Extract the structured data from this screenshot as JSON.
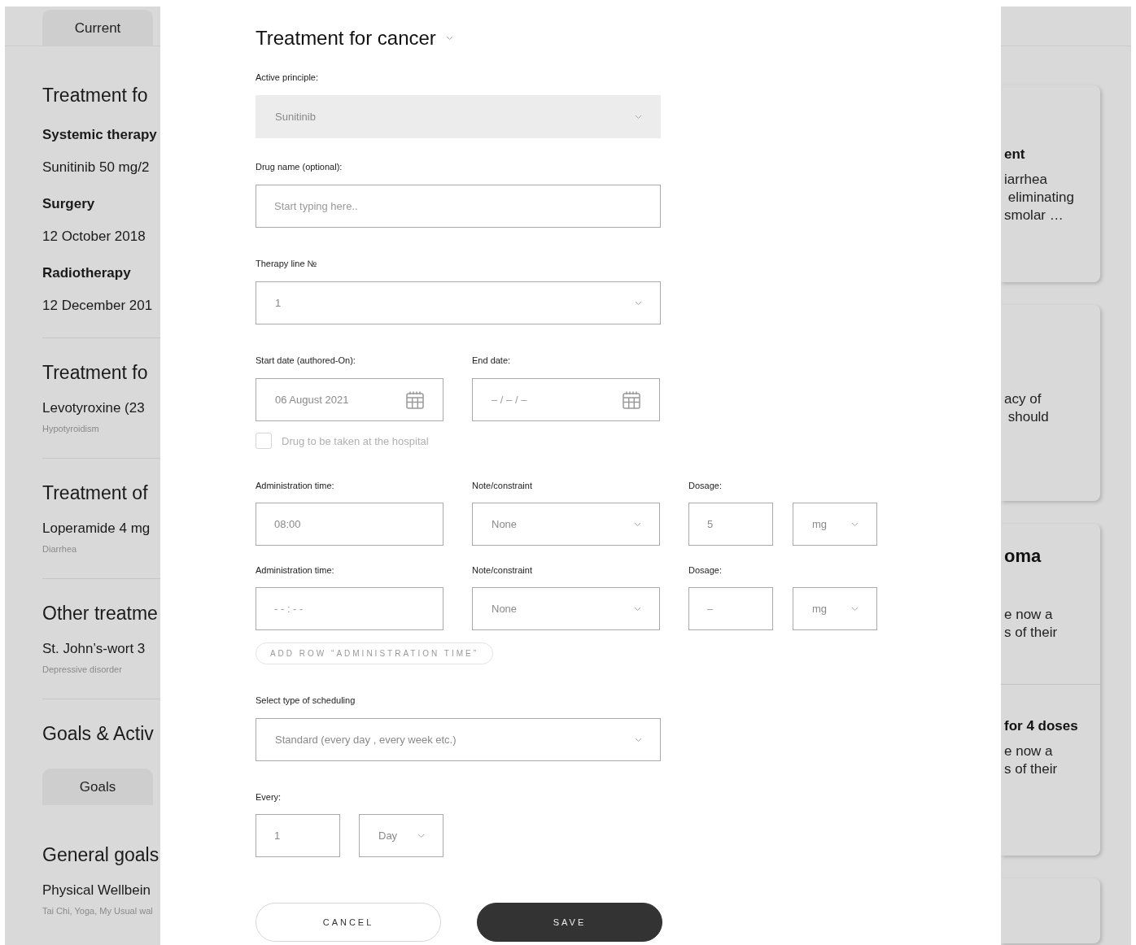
{
  "background": {
    "top_tab": {
      "label": "Current"
    },
    "sections": [
      {
        "title": "Treatment fo",
        "entries": [
          {
            "kind": "subheading",
            "text": "Systemic therapy"
          },
          {
            "kind": "value",
            "text": "Sunitinib 50 mg/2"
          },
          {
            "kind": "subheading",
            "text": "Surgery"
          },
          {
            "kind": "value",
            "text": "12 October 2018"
          },
          {
            "kind": "subheading",
            "text": "Radiotherapy"
          },
          {
            "kind": "value",
            "text": "12 December 201"
          }
        ]
      },
      {
        "title": "Treatment fo",
        "entries": [
          {
            "kind": "value",
            "text": "Levotyroxine (23"
          },
          {
            "kind": "note",
            "text": "Hypotyroidism"
          }
        ]
      },
      {
        "title": "Treatment of",
        "entries": [
          {
            "kind": "value",
            "text": "Loperamide 4 mg"
          },
          {
            "kind": "note",
            "text": "Diarrhea"
          }
        ]
      },
      {
        "title": "Other treatme",
        "entries": [
          {
            "kind": "value",
            "text": "St. John’s-wort 3"
          },
          {
            "kind": "note",
            "text": "Depressive disorder"
          }
        ]
      },
      {
        "title": "Goals & Activ",
        "entries": [
          {
            "kind": "tab",
            "text": "Goals"
          },
          {
            "kind": "heading",
            "text": "General goals"
          },
          {
            "kind": "value",
            "text": "Physical Wellbein"
          },
          {
            "kind": "note",
            "text": "Tai Chi, Yoga, My Usual wal"
          }
        ]
      }
    ],
    "cards": [
      {
        "sections": [
          {
            "title": "ent",
            "kind": "small",
            "lines": [
              "iarrhea",
              " eliminating",
              "smolar …"
            ]
          }
        ]
      },
      {
        "sections": [
          {
            "lines": [
              "acy of",
              " should"
            ]
          }
        ]
      },
      {
        "sections": [
          {
            "title": "oma",
            "kind": "large",
            "lines": [
              "e now a",
              "s of their"
            ]
          },
          {
            "title": "for 4 doses",
            "kind": "small",
            "lines": [
              "e now a",
              "s of their"
            ]
          }
        ]
      }
    ]
  },
  "form": {
    "title": "Treatment for cancer",
    "active_principle": {
      "label": "Active principle:",
      "value": "Sunitinib",
      "disabled": true
    },
    "drug_name": {
      "label": "Drug name (optional):",
      "placeholder": "Start typing here.."
    },
    "therapy_line": {
      "label": "Therapy line №",
      "value": "1"
    },
    "start_date": {
      "label": "Start date (authored-On):",
      "value": "06 August 2021"
    },
    "end_date": {
      "label": "End date:",
      "placeholder": "– / – / –"
    },
    "hospital_checkbox": {
      "label": "Drug to be taken at the hospital",
      "checked": false
    },
    "administration_rows": [
      {
        "time_label": "Administration time:",
        "time": "08:00",
        "note_label": "Note/constraint",
        "note": "None",
        "dosage_label": "Dosage:",
        "dose": "5",
        "unit": "mg"
      },
      {
        "time_label": "Administration time:",
        "time_placeholder": "- - : - -",
        "note_label": "Note/constraint",
        "note": "None",
        "dosage_label": "Dosage:",
        "dose_placeholder": "–",
        "unit": "mg"
      }
    ],
    "add_row_button": "ADD ROW “ADMINISTRATION TIME”",
    "scheduling": {
      "label": "Select type of scheduling",
      "value": "Standard (every day , every week etc.)"
    },
    "every": {
      "label": "Every:",
      "value": "1",
      "unit": "Day"
    },
    "buttons": [
      {
        "label": "CANCEL",
        "kind": "secondary"
      },
      {
        "label": "SAVE",
        "kind": "primary"
      }
    ]
  }
}
